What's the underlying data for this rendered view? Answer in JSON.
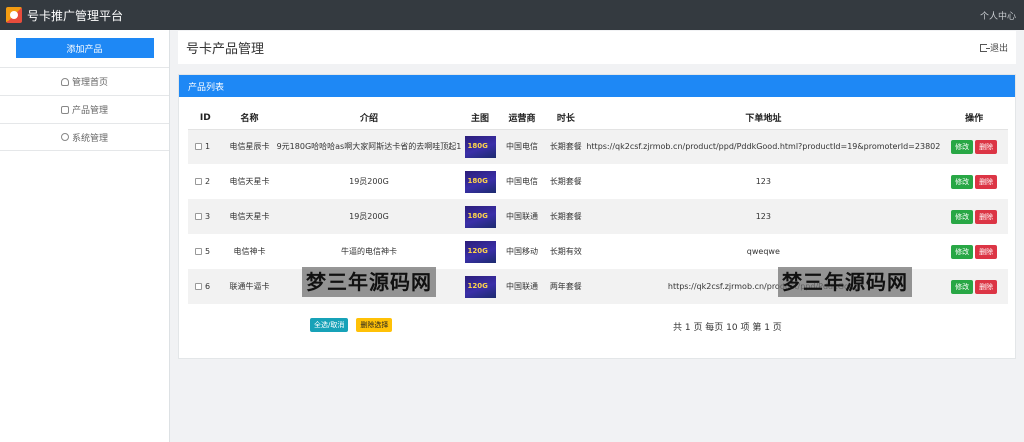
{
  "app": {
    "title": "号卡推广管理平台",
    "user_center": "个人中心"
  },
  "sidebar": {
    "add_button": "添加产品",
    "items": [
      {
        "label": "管理首页",
        "icon": "home-icon"
      },
      {
        "label": "产品管理",
        "icon": "document-icon"
      },
      {
        "label": "系统管理",
        "icon": "user-icon"
      }
    ]
  },
  "header": {
    "title": "号卡产品管理",
    "logout": "退出"
  },
  "panel": {
    "title": "产品列表",
    "columns": [
      "ID",
      "名称",
      "介绍",
      "主图",
      "运营商",
      "时长",
      "下单地址",
      "操作"
    ],
    "rows": [
      {
        "id": "1",
        "name": "电信星辰卡",
        "intro": "9元180G哈哈哈as啊大家阿斯达卡省的去啊哇顶起1",
        "thumb": "180G",
        "carrier": "中国电信",
        "duration": "长期套餐",
        "link": "https://qk2csf.zjrmob.cn/product/ppd/PddkGood.html?productId=19&promoterId=23802"
      },
      {
        "id": "2",
        "name": "电信天星卡",
        "intro": "19员200G",
        "thumb": "180G",
        "carrier": "中国电信",
        "duration": "长期套餐",
        "link": "123"
      },
      {
        "id": "3",
        "name": "电信天星卡",
        "intro": "19员200G",
        "thumb": "180G",
        "carrier": "中国联通",
        "duration": "长期套餐",
        "link": "123"
      },
      {
        "id": "5",
        "name": "电信神卡",
        "intro": "牛逼的电信神卡",
        "thumb": "120G",
        "carrier": "中国移动",
        "duration": "长期有效",
        "link": "qweqwe"
      },
      {
        "id": "6",
        "name": "联通牛逼卡",
        "intro": "",
        "thumb": "120G",
        "carrier": "中国联通",
        "duration": "两年套餐",
        "link": "https://qk2csf.zjrmob.cn/product/ppd/PddkGood"
      }
    ],
    "edit_label": "修改",
    "delete_label": "删除",
    "select_all": "全选/取消",
    "bulk_delete": "删除选择",
    "pagination": "共 1 页  每页 10 项   第 1 页"
  },
  "watermark": "梦三年源码网",
  "colors": {
    "topbar": "#343a40",
    "primary": "#1e88f5",
    "success": "#28a745",
    "danger": "#dc3545",
    "info": "#17a2b8",
    "warning": "#ffc107"
  }
}
